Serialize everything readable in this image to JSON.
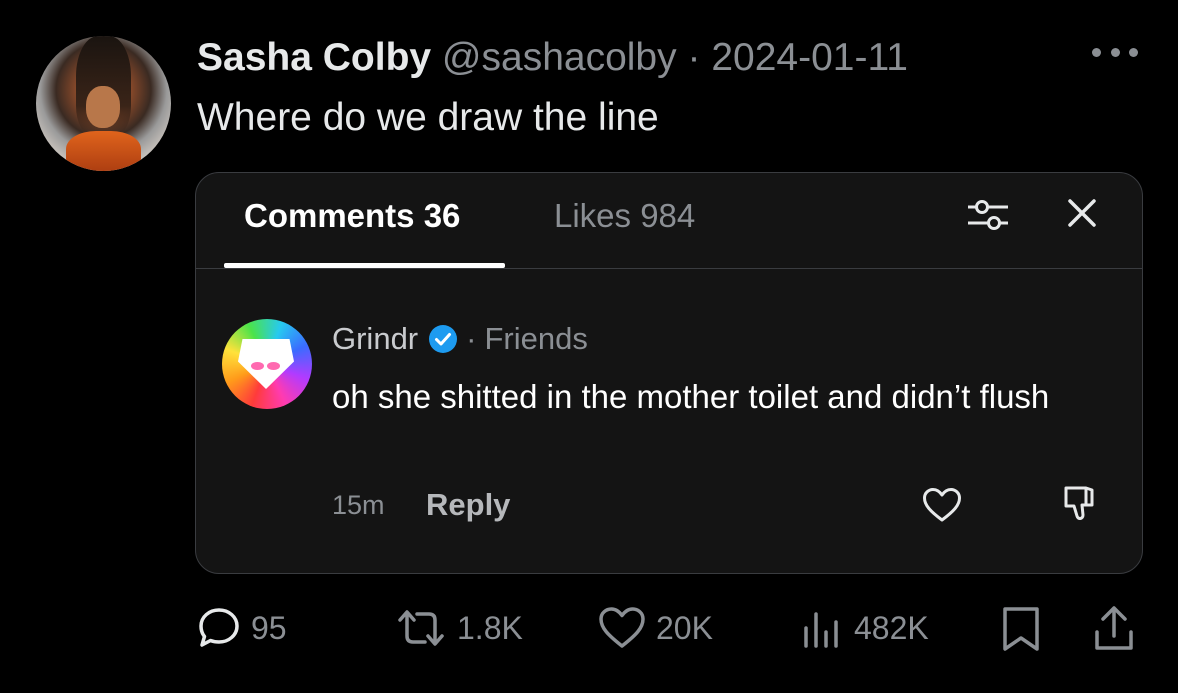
{
  "tweet": {
    "author_name": "Sasha Colby",
    "handle": "@sashacolby",
    "separator": "·",
    "date": "2024-01-11",
    "text": "Where do we draw the line"
  },
  "comments_panel": {
    "tabs": [
      {
        "label": "Comments 36",
        "active": true
      },
      {
        "label": "Likes 984",
        "active": false
      }
    ],
    "comment": {
      "author": "Grindr",
      "separator": "·",
      "relation": "Friends",
      "text": "oh she shitted in the mother toilet and didn’t flush",
      "time": "15m",
      "reply_label": "Reply"
    }
  },
  "actions": {
    "replies": "95",
    "reposts": "1.8K",
    "likes": "20K",
    "views": "482K"
  },
  "colors": {
    "background": "#000000",
    "card_background": "#141414",
    "muted_text": "#8b8f94",
    "verified_blue": "#1d9bf0"
  },
  "icons": [
    "more-icon",
    "filter-icon",
    "close-icon",
    "verified-icon",
    "heart-icon",
    "dislike-icon",
    "reply-icon",
    "repost-icon",
    "views-icon",
    "bookmark-icon",
    "share-icon"
  ]
}
